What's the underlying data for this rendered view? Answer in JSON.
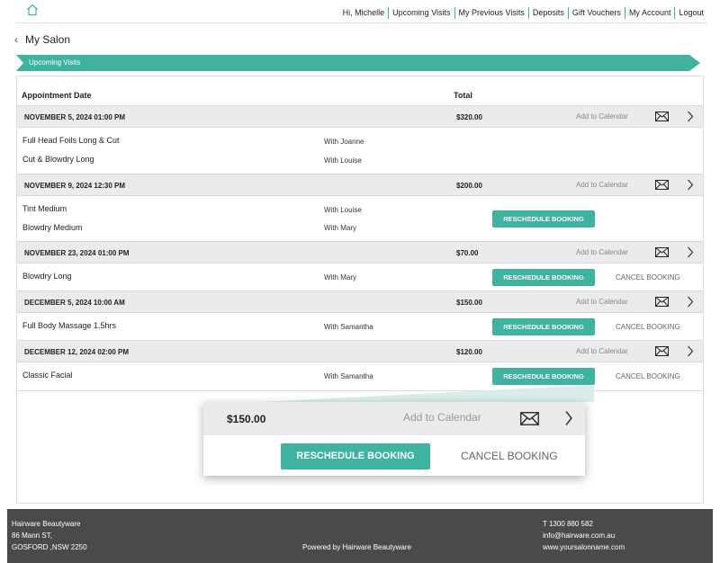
{
  "nav": {
    "greeting": "Hi, Michelle",
    "links": [
      "Upcoming Visits",
      "My Previous Visits",
      "Deposits",
      "Gift Vouchers",
      "My Account",
      "Logout"
    ]
  },
  "breadcrumb": {
    "title": "My Salon"
  },
  "ribbon": {
    "label": "Upcoming Visits"
  },
  "table": {
    "col_date": "Appointment Date",
    "col_total": "Total",
    "add_to_calendar": "Add to Calendar",
    "reschedule": "RESCHEDULE BOOKING",
    "cancel": "CANCEL BOOKING",
    "groups": [
      {
        "date": "NOVEMBER 5, 2024 01:00 PM",
        "total": "$320.00",
        "services": [
          {
            "name": "Full Head Foils Long & Cut",
            "staff": "With Joanne"
          },
          {
            "name": "Cut & Blowdry Long",
            "staff": "With Louise"
          }
        ]
      },
      {
        "date": "NOVEMBER 9, 2024 12:30 PM",
        "total": "$200.00",
        "services": [
          {
            "name": "Tint Medium",
            "staff": "With Louise"
          },
          {
            "name": "Blowdry Medium",
            "staff": "With Mary"
          }
        ]
      },
      {
        "date": "NOVEMBER 23, 2024 01:00 PM",
        "total": "$70.00",
        "services": [
          {
            "name": "Blowdry Long",
            "staff": "With Mary"
          }
        ]
      },
      {
        "date": "DECEMBER 5, 2024 10:00 AM",
        "total": "$150.00",
        "services": [
          {
            "name": "Full Body Massage 1.5hrs",
            "staff": "With Samantha"
          }
        ]
      },
      {
        "date": "DECEMBER 12, 2024 02:00 PM",
        "total": "$120.00",
        "services": [
          {
            "name": "Classic Facial",
            "staff": "With Samantha"
          }
        ]
      }
    ]
  },
  "zoom": {
    "total": "$150.00",
    "add_to_calendar": "Add to Calendar",
    "reschedule": "RESCHEDULE BOOKING",
    "cancel": "CANCEL BOOKING"
  },
  "footer": {
    "company": "Hairware Beautyware",
    "address1": "86 Mann ST,",
    "address2": "GOSFORD ,NSW 2250",
    "powered": "Powered by Hairware Beautyware",
    "phone": "T 1300 880 582",
    "email": "info@hairware.com.au",
    "website": "www.yoursalonname.com"
  },
  "colors": {
    "accent": "#3fb39f",
    "footer_bg": "#4a4a4a",
    "row_bg": "#e9ebed"
  }
}
